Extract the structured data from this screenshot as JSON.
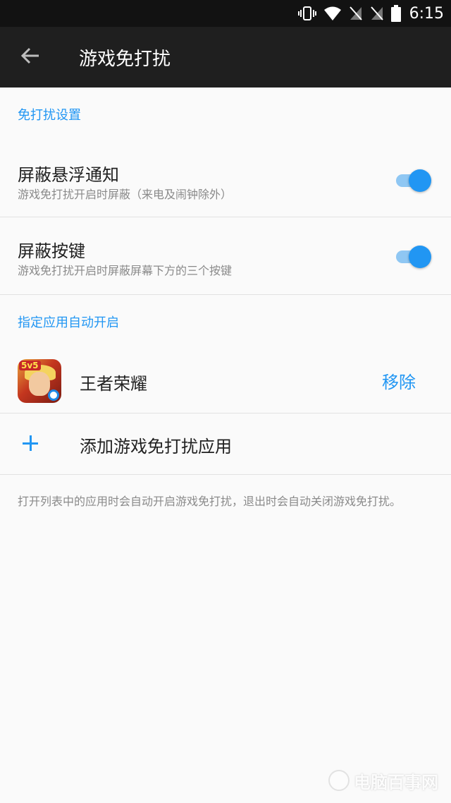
{
  "status_bar": {
    "time": "6:15",
    "icons": [
      "vibrate-icon",
      "wifi-icon",
      "no-sim-icon",
      "no-sim-icon",
      "battery-icon"
    ]
  },
  "app_bar": {
    "title": "游戏免打扰",
    "back_icon": "arrow-back-icon"
  },
  "sections": {
    "settings_header": "免打扰设置",
    "auto_header": "指定应用自动开启"
  },
  "settings": [
    {
      "title": "屏蔽悬浮通知",
      "subtitle": "游戏免打扰开启时屏蔽（来电及闹钟除外）",
      "enabled": true
    },
    {
      "title": "屏蔽按键",
      "subtitle": "游戏免打扰开启时屏蔽屏幕下方的三个按键",
      "enabled": true
    }
  ],
  "apps": [
    {
      "name": "王者荣耀",
      "badge": "5v5",
      "action": "移除"
    }
  ],
  "add_app": {
    "label": "添加游戏免打扰应用",
    "icon": "plus-icon"
  },
  "footer_note": "打开列表中的应用时会自动开启游戏免打扰，退出时会自动关闭游戏免打扰。",
  "watermark": "电脑百事网",
  "colors": {
    "accent": "#2196f3",
    "app_bar": "#1f1f1f",
    "status_bar": "#121212",
    "background": "#fafafa"
  }
}
